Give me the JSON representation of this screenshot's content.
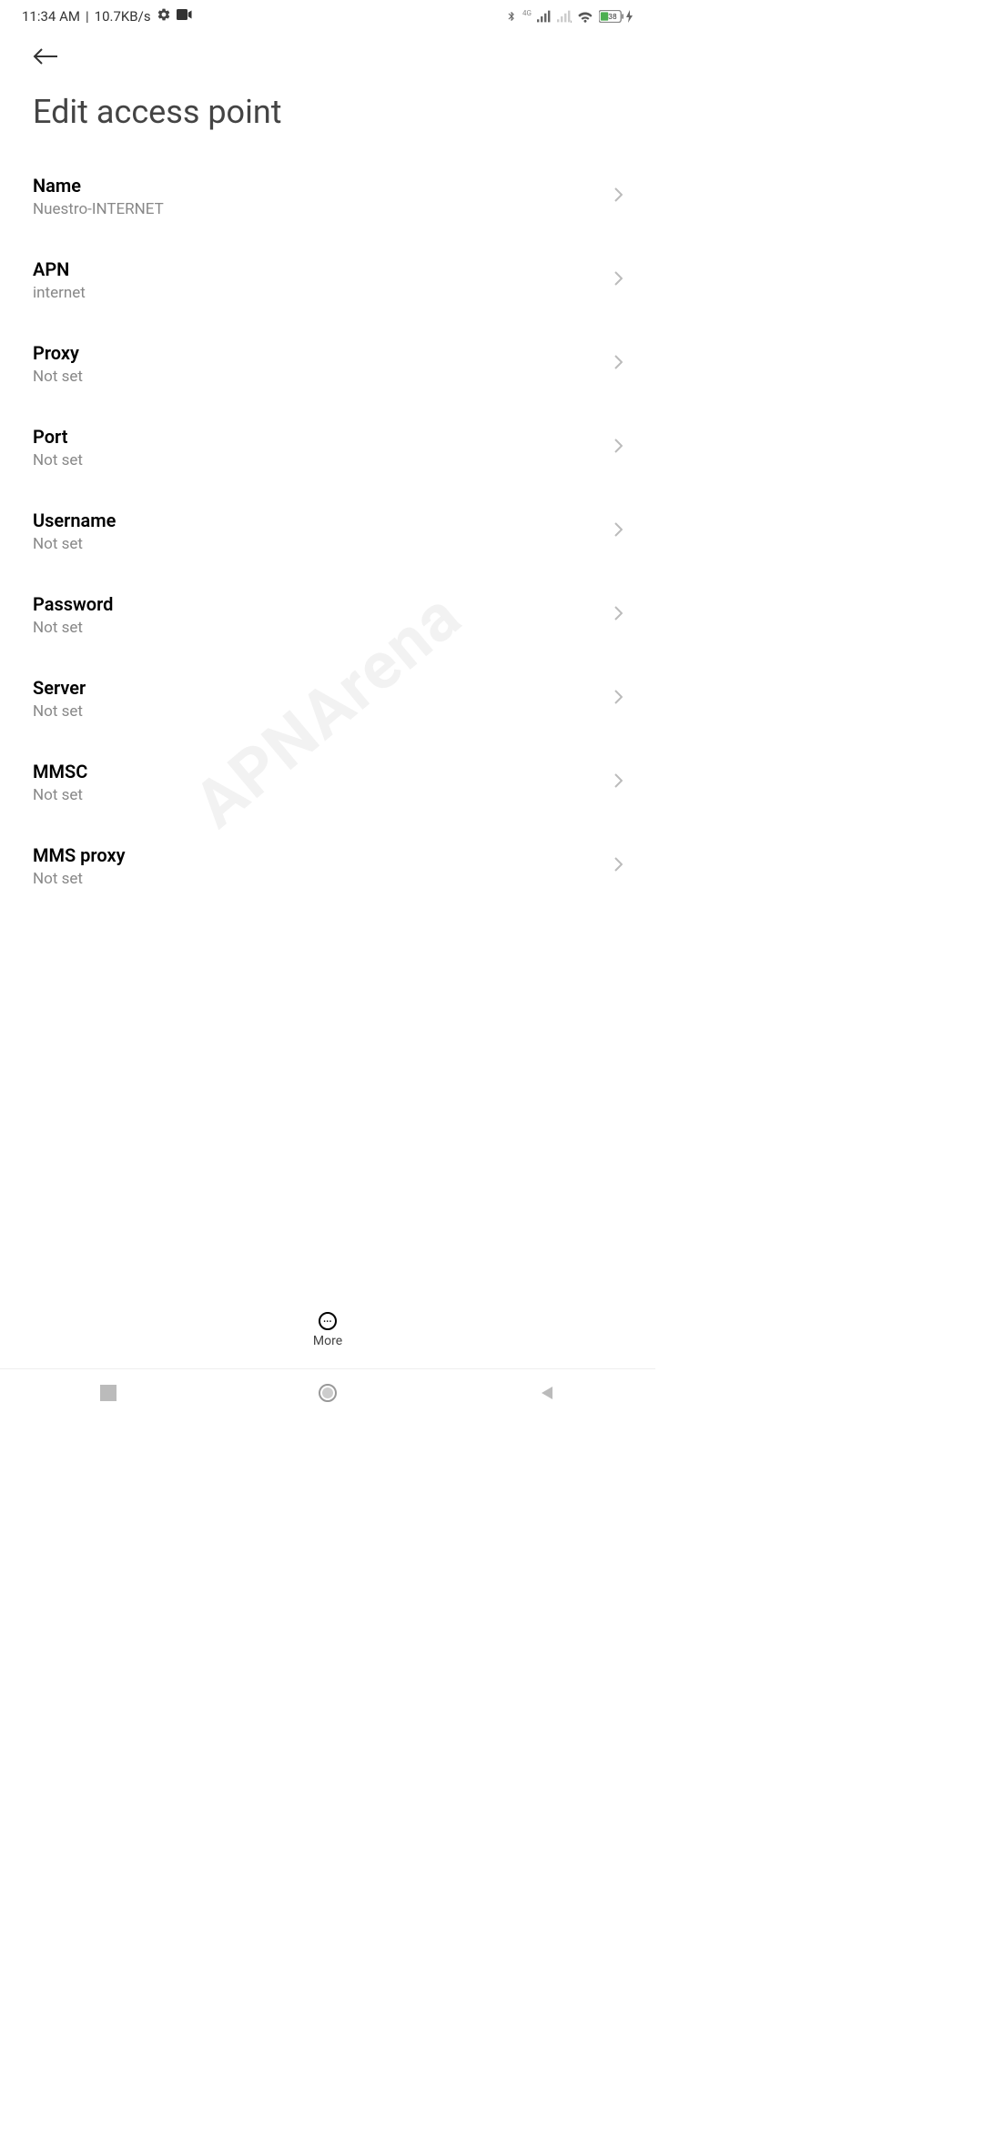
{
  "status": {
    "time": "11:34 AM",
    "speed": "10.7KB/s",
    "battery": "38",
    "network": "4G"
  },
  "page": {
    "title": "Edit access point"
  },
  "settings": [
    {
      "label": "Name",
      "value": "Nuestro-INTERNET"
    },
    {
      "label": "APN",
      "value": "internet"
    },
    {
      "label": "Proxy",
      "value": "Not set"
    },
    {
      "label": "Port",
      "value": "Not set"
    },
    {
      "label": "Username",
      "value": "Not set"
    },
    {
      "label": "Password",
      "value": "Not set"
    },
    {
      "label": "Server",
      "value": "Not set"
    },
    {
      "label": "MMSC",
      "value": "Not set"
    },
    {
      "label": "MMS proxy",
      "value": "Not set"
    }
  ],
  "toolbar": {
    "more": "More"
  },
  "watermark": "APNArena"
}
